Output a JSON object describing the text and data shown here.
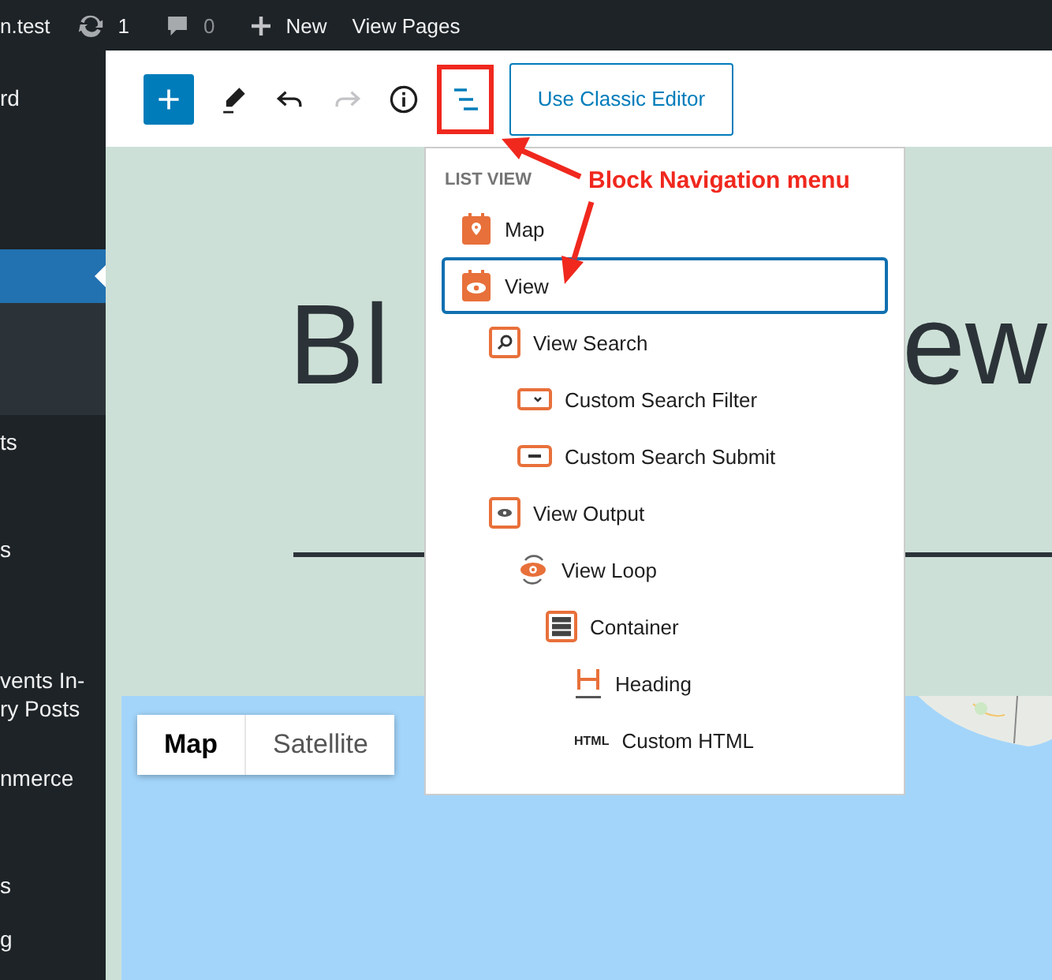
{
  "admin_bar": {
    "site": "n.test",
    "updates": "1",
    "comments": "0",
    "new": "New",
    "view": "View Pages"
  },
  "sidebar": {
    "items": [
      {
        "label": "rd",
        "selected": false
      },
      {
        "selected": true
      },
      {
        "kind": "submenu"
      },
      {
        "label": "ts",
        "selected": false
      },
      {
        "label": "s",
        "selected": false
      },
      {
        "label": "vents In-\nry Posts",
        "selected": false
      },
      {
        "label": "nmerce",
        "selected": false
      },
      {
        "label": "s",
        "selected": false
      },
      {
        "label": "g",
        "selected": false
      }
    ]
  },
  "toolbar": {
    "redo_disabled": true,
    "list_view_selected": true,
    "classic_button": "Use Classic Editor"
  },
  "content": {
    "heading_left": "Bl",
    "heading_right": "ew",
    "map_types": [
      {
        "label": "Map",
        "selected": true
      },
      {
        "label": "Satellite",
        "selected": false
      }
    ]
  },
  "list_view": {
    "title": "LIST VIEW",
    "items": [
      {
        "label": "Map",
        "kind": "map",
        "selected": false
      },
      {
        "label": "View",
        "kind": "view",
        "selected": true,
        "children": [
          {
            "label": "View Search",
            "kind": "search",
            "selected": false,
            "children": [
              {
                "label": "Custom Search Filter",
                "kind": "filter",
                "selected": false
              },
              {
                "label": "Custom Search Submit",
                "kind": "submit",
                "selected": false
              }
            ]
          },
          {
            "label": "View Output",
            "kind": "output",
            "selected": false,
            "children": [
              {
                "label": "View Loop",
                "kind": "loop",
                "selected": false,
                "children": [
                  {
                    "label": "Container",
                    "kind": "container",
                    "selected": false,
                    "children": [
                      {
                        "label": "Heading",
                        "kind": "heading",
                        "selected": false
                      },
                      {
                        "label": "Custom HTML",
                        "kind": "html",
                        "icon_text": "HTML",
                        "selected": false
                      }
                    ]
                  }
                ]
              }
            ]
          }
        ]
      }
    ]
  },
  "annotation": {
    "label": "Block Navigation menu"
  }
}
